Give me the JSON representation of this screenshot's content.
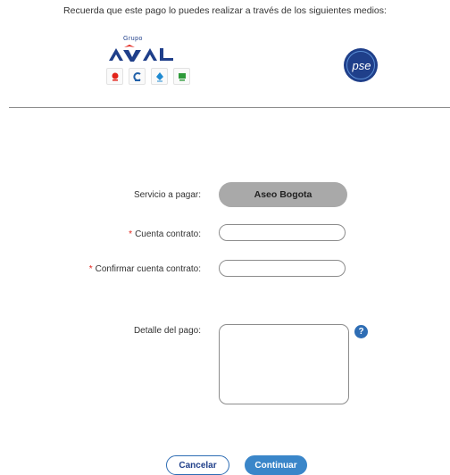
{
  "header": {
    "intro_text": "Recuerda que este pago lo puedes realizar a través de los siguientes medios:"
  },
  "logos": {
    "aval_small_text": "Grupo",
    "aval_name": "AVAL",
    "pse_text": "pse",
    "banks": [
      "banco-bogota-icon",
      "banco-occidente-icon",
      "banco-popular-icon",
      "banco-av-villas-icon"
    ]
  },
  "form": {
    "service_label": "Servicio a pagar:",
    "service_value": "Aseo Bogota",
    "account_label": "Cuenta contrato:",
    "confirm_account_label": "Confirmar cuenta contrato:",
    "required_mark": "*",
    "detail_label": "Detalle del pago:",
    "help_symbol": "?"
  },
  "actions": {
    "cancel_label": "Cancelar",
    "continue_label": "Continuar"
  },
  "colors": {
    "brand_blue": "#1f3f8a",
    "accent_blue": "#3a86c9",
    "required_red": "#e2231a",
    "pill_gray": "#a9a9a9"
  }
}
